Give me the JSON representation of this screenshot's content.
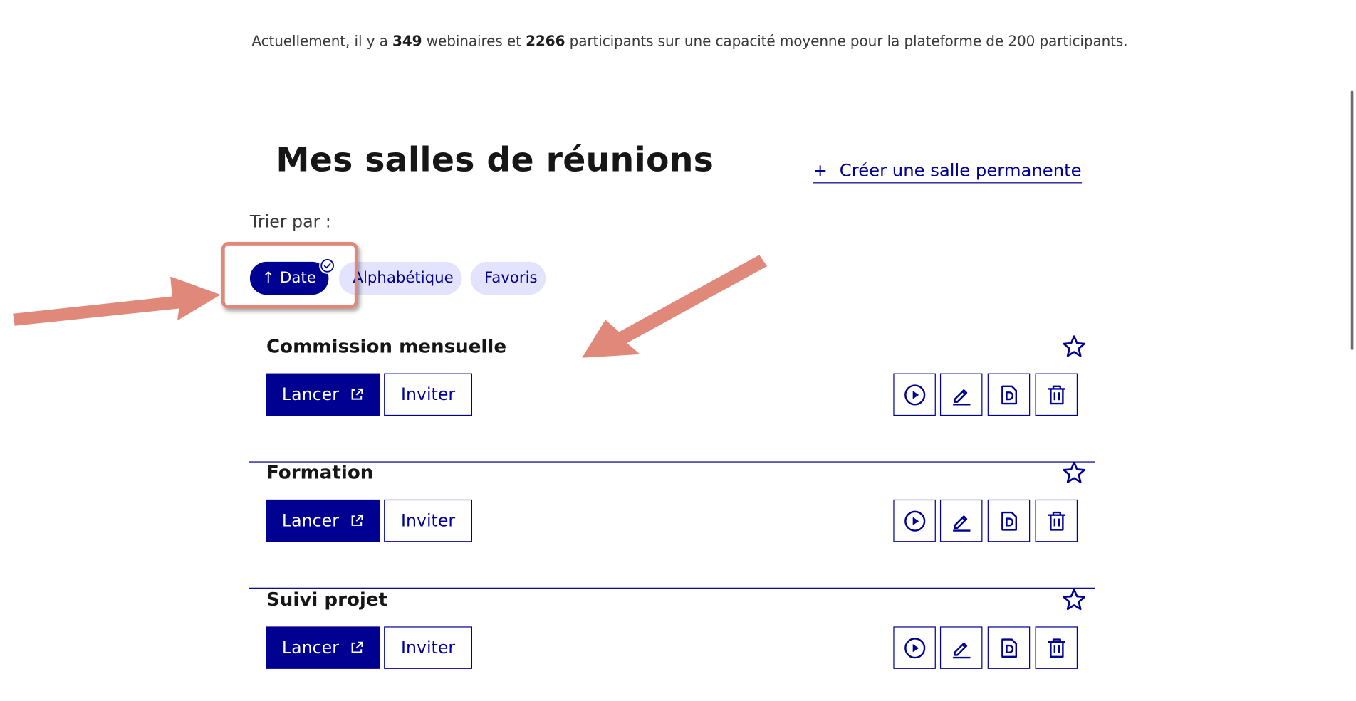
{
  "stats": {
    "prefix": "Actuellement, il y a ",
    "webinars": "349",
    "mid1": " webinaires et ",
    "participants": "2266",
    "suffix": " participants sur une capacité moyenne pour la plateforme de 200 participants."
  },
  "header": {
    "title": "Mes salles de réunions",
    "create_plus": "+",
    "create_label": "Créer une salle permanente"
  },
  "sort": {
    "label": "Trier par :",
    "arrow": "↑",
    "options": [
      "Date",
      "Alphabétique",
      "Favoris"
    ],
    "selected": "Date"
  },
  "rooms": [
    {
      "title": "Commission mensuelle",
      "launch_label": "Lancer",
      "invite_label": "Inviter"
    },
    {
      "title": "Formation",
      "launch_label": "Lancer",
      "invite_label": "Inviter"
    },
    {
      "title": "Suivi projet",
      "launch_label": "Lancer",
      "invite_label": "Inviter"
    }
  ],
  "room_actions": [
    "play-icon",
    "edit-icon",
    "document-icon",
    "trash-icon"
  ],
  "colors": {
    "primary": "#000091",
    "tag_background": "#e3e3fd",
    "annotation": "#e0897b"
  }
}
